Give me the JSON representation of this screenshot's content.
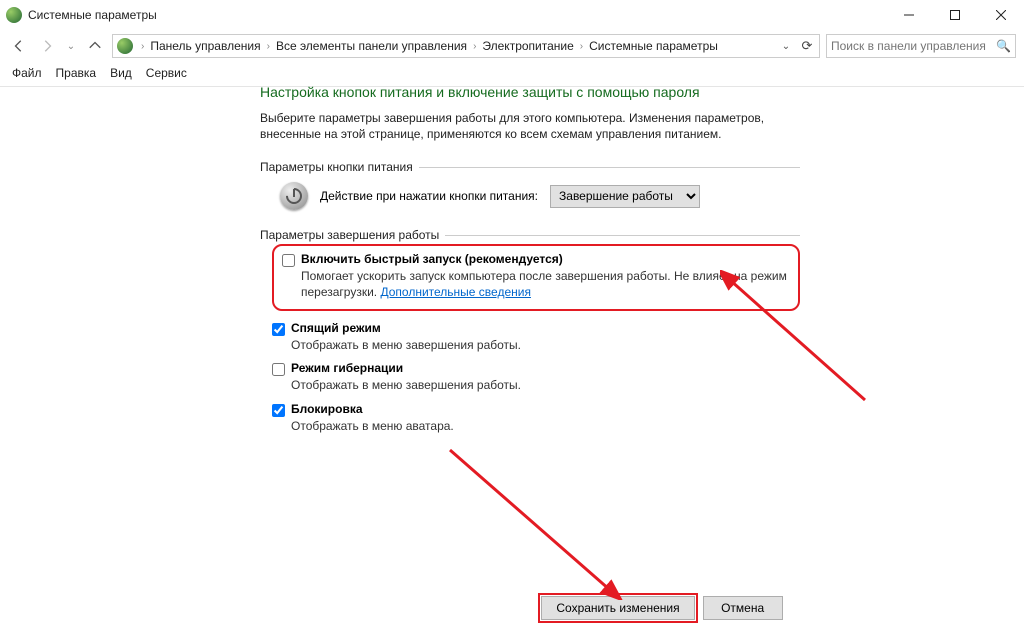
{
  "window": {
    "title": "Системные параметры"
  },
  "breadcrumbs": {
    "b0": "Панель управления",
    "b1": "Все элементы панели управления",
    "b2": "Электропитание",
    "b3": "Системные параметры"
  },
  "search": {
    "placeholder": "Поиск в панели управления"
  },
  "menu": {
    "file": "Файл",
    "edit": "Правка",
    "view": "Вид",
    "service": "Сервис"
  },
  "page": {
    "heading": "Настройка кнопок питания и включение защиты с помощью пароля",
    "description": "Выберите параметры завершения работы для этого компьютера. Изменения параметров, внесенные на этой странице, применяются ко всем схемам управления питанием.",
    "section_power_button": "Параметры кнопки питания",
    "power_action_label": "Действие при нажатии кнопки питания:",
    "power_action_value": "Завершение работы",
    "section_shutdown": "Параметры завершения работы",
    "fast_startup": {
      "label": "Включить быстрый запуск (рекомендуется)",
      "desc_prefix": "Помогает ускорить запуск компьютера после завершения работы. Не влияет на режим перезагрузки. ",
      "link": "Дополнительные сведения"
    },
    "sleep": {
      "label": "Спящий режим",
      "desc": "Отображать в меню завершения работы."
    },
    "hibernate": {
      "label": "Режим гибернации",
      "desc": "Отображать в меню завершения работы."
    },
    "lock": {
      "label": "Блокировка",
      "desc": "Отображать в меню аватара."
    }
  },
  "buttons": {
    "save": "Сохранить изменения",
    "cancel": "Отмена"
  }
}
